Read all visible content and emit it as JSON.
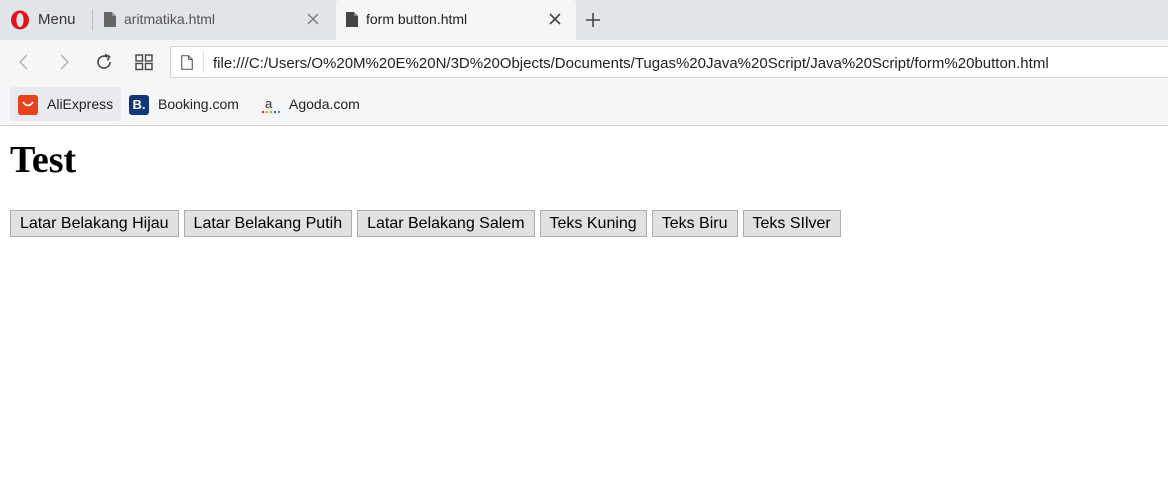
{
  "browser": {
    "menu_label": "Menu",
    "tabs": [
      {
        "title": "aritmatika.html",
        "active": false
      },
      {
        "title": "form button.html",
        "active": true
      }
    ],
    "address": "file:///C:/Users/O%20M%20E%20N/3D%20Objects/Documents/Tugas%20Java%20Script/Java%20Script/form%20button.html",
    "bookmarks": [
      {
        "label": "AliExpress",
        "icon": "aliexpress-icon",
        "color": "#e8411c"
      },
      {
        "label": "Booking.com",
        "icon": "booking-icon",
        "icon_text": "B.",
        "color": "#12367a"
      },
      {
        "label": "Agoda.com",
        "icon": "agoda-icon"
      }
    ]
  },
  "page": {
    "title": "Test",
    "buttons": [
      "Latar Belakang Hijau",
      "Latar Belakang Putih",
      "Latar Belakang Salem",
      "Teks Kuning",
      "Teks Biru",
      "Teks SIlver"
    ]
  }
}
